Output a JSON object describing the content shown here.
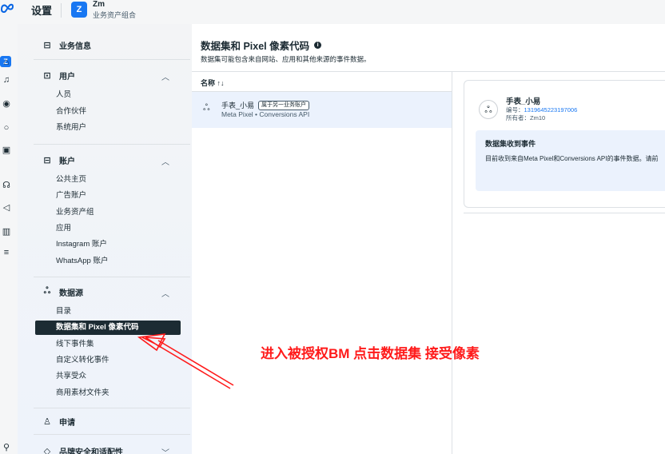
{
  "header": {
    "logo_icon": "meta-logo-icon",
    "title": "设置",
    "business_initial": "Z",
    "business_name": "Zm",
    "business_subtitle": "业务资产组合"
  },
  "rail": {
    "active_initial": "Z",
    "icons": [
      "home-icon",
      "bell-icon",
      "compass-icon",
      "circle-icon",
      "briefcase-icon",
      "palette-icon",
      "megaphone-icon",
      "chart-icon",
      "menu-icon",
      "search-icon"
    ]
  },
  "sidebar": {
    "business_info": "业务信息",
    "users": {
      "label": "用户",
      "items": [
        "人员",
        "合作伙伴",
        "系统用户"
      ]
    },
    "accounts": {
      "label": "账户",
      "items": [
        "公共主页",
        "广告账户",
        "业务资产组",
        "应用",
        "Instagram 账户",
        "WhatsApp 账户"
      ]
    },
    "data_sources": {
      "label": "数据源",
      "items": [
        "目录",
        "数据集和 Pixel 像素代码",
        "线下事件集",
        "自定义转化事件",
        "共享受众",
        "商用素材文件夹"
      ],
      "active_index": 1
    },
    "requests": "申请",
    "brand_safety": "品牌安全和适配性"
  },
  "main": {
    "title": "数据集和 Pixel 像素代码",
    "description": "数据集可能包含来自网站、应用和其他来源的事件数据。",
    "column_header": "名称",
    "sort_icon": "sort-icon",
    "rows": [
      {
        "name": "手表_小易",
        "badge": "属于另一业务账户",
        "subtitle": "Meta Pixel • Conversions API"
      }
    ]
  },
  "detail": {
    "name": "手表_小易",
    "id_label": "编号：",
    "id_value": "1319645223197006",
    "owner": "所有者：Zm10",
    "event_title": "数据集收到事件",
    "event_desc": "目前收到来自Meta Pixel和Conversions API的事件数据。请前"
  },
  "annotation": {
    "text": "进入被授权BM 点击数据集 接受像素",
    "color": "#ff1a1a"
  },
  "colors": {
    "accent": "#1877f2",
    "active_nav": "#1c2b33",
    "selected_row": "#ebf2fd"
  }
}
